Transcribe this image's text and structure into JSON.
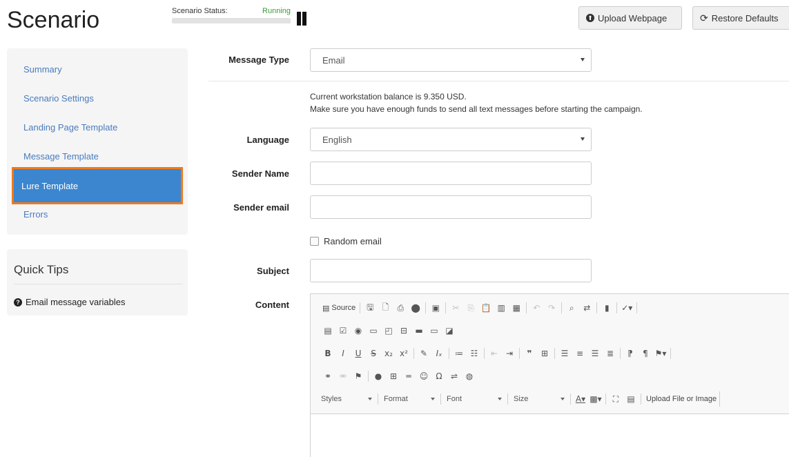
{
  "header": {
    "title": "Scenario",
    "status_label": "Scenario Status:",
    "status_value": "Running",
    "upload_button": "Upload Webpage",
    "restore_button": "Restore Defaults"
  },
  "sidebar": {
    "items": [
      {
        "label": "Summary"
      },
      {
        "label": "Scenario Settings"
      },
      {
        "label": "Landing Page Template"
      },
      {
        "label": "Message Template"
      },
      {
        "label": "Lure Template"
      },
      {
        "label": "Errors"
      }
    ],
    "active_index": 4
  },
  "quick_tips": {
    "title": "Quick Tips",
    "link": "Email message variables"
  },
  "form": {
    "message_type_label": "Message Type",
    "message_type_value": "Email",
    "balance_line1": "Current workstation balance is 9.350 USD.",
    "balance_line2": "Make sure you have enough funds to send all text messages before starting the campaign.",
    "language_label": "Language",
    "language_value": "English",
    "sender_name_label": "Sender Name",
    "sender_name_value": "",
    "sender_email_label": "Sender email",
    "sender_email_value": "",
    "random_email_label": "Random email",
    "subject_label": "Subject",
    "subject_value": "",
    "content_label": "Content"
  },
  "editor": {
    "source_label": "Source",
    "styles_label": "Styles",
    "format_label": "Format",
    "font_label": "Font",
    "size_label": "Size",
    "upload_label": "Upload File or Image"
  },
  "colors": {
    "active_item_bg": "#3b86cf",
    "active_item_border": "#f07a1c",
    "link": "#4a7bbd",
    "status_running": "#3c9a3c"
  }
}
